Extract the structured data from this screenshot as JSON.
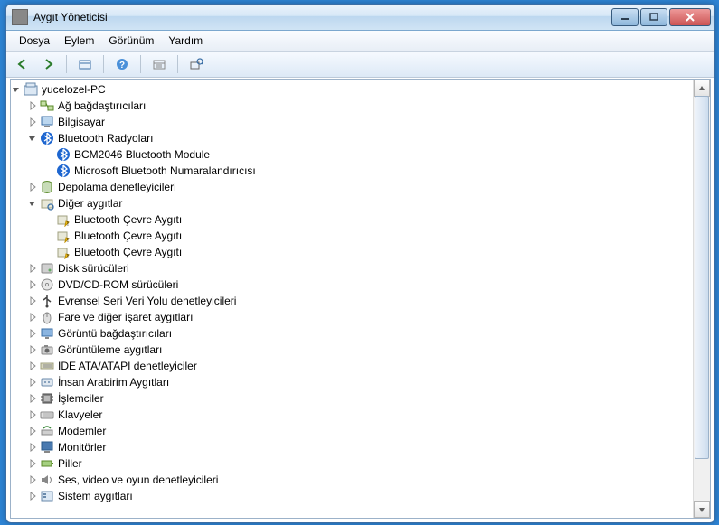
{
  "window": {
    "title": "Aygıt Yöneticisi"
  },
  "menu": {
    "file": "Dosya",
    "action": "Eylem",
    "view": "Görünüm",
    "help": "Yardım"
  },
  "tree": {
    "root": "yucelozel-PC",
    "nodes": [
      {
        "label": "Ağ bağdaştırıcıları",
        "icon": "network",
        "expanded": false
      },
      {
        "label": "Bilgisayar",
        "icon": "computer",
        "expanded": false
      },
      {
        "label": "Bluetooth Radyoları",
        "icon": "bluetooth",
        "expanded": true,
        "children": [
          {
            "label": "BCM2046 Bluetooth Module",
            "icon": "bluetooth"
          },
          {
            "label": "Microsoft Bluetooth Numaralandırıcısı",
            "icon": "bluetooth"
          }
        ]
      },
      {
        "label": "Depolama denetleyicileri",
        "icon": "storage",
        "expanded": false
      },
      {
        "label": "Diğer aygıtlar",
        "icon": "other",
        "expanded": true,
        "children": [
          {
            "label": "Bluetooth Çevre Aygıtı",
            "icon": "unknown"
          },
          {
            "label": "Bluetooth Çevre Aygıtı",
            "icon": "unknown"
          },
          {
            "label": "Bluetooth Çevre Aygıtı",
            "icon": "unknown"
          }
        ]
      },
      {
        "label": "Disk sürücüleri",
        "icon": "disk",
        "expanded": false
      },
      {
        "label": "DVD/CD-ROM sürücüleri",
        "icon": "dvd",
        "expanded": false
      },
      {
        "label": "Evrensel Seri Veri Yolu denetleyicileri",
        "icon": "usb",
        "expanded": false
      },
      {
        "label": "Fare ve diğer işaret aygıtları",
        "icon": "mouse",
        "expanded": false
      },
      {
        "label": "Görüntü bağdaştırıcıları",
        "icon": "display",
        "expanded": false
      },
      {
        "label": "Görüntüleme aygıtları",
        "icon": "imaging",
        "expanded": false
      },
      {
        "label": "IDE ATA/ATAPI denetleyiciler",
        "icon": "ide",
        "expanded": false
      },
      {
        "label": "İnsan Arabirim Aygıtları",
        "icon": "hid",
        "expanded": false
      },
      {
        "label": "İşlemciler",
        "icon": "cpu",
        "expanded": false
      },
      {
        "label": "Klavyeler",
        "icon": "keyboard",
        "expanded": false
      },
      {
        "label": "Modemler",
        "icon": "modem",
        "expanded": false
      },
      {
        "label": "Monitörler",
        "icon": "monitor",
        "expanded": false
      },
      {
        "label": "Piller",
        "icon": "battery",
        "expanded": false
      },
      {
        "label": "Ses, video ve oyun denetleyicileri",
        "icon": "sound",
        "expanded": false
      },
      {
        "label": "Sistem aygıtları",
        "icon": "system",
        "expanded": false
      }
    ]
  }
}
